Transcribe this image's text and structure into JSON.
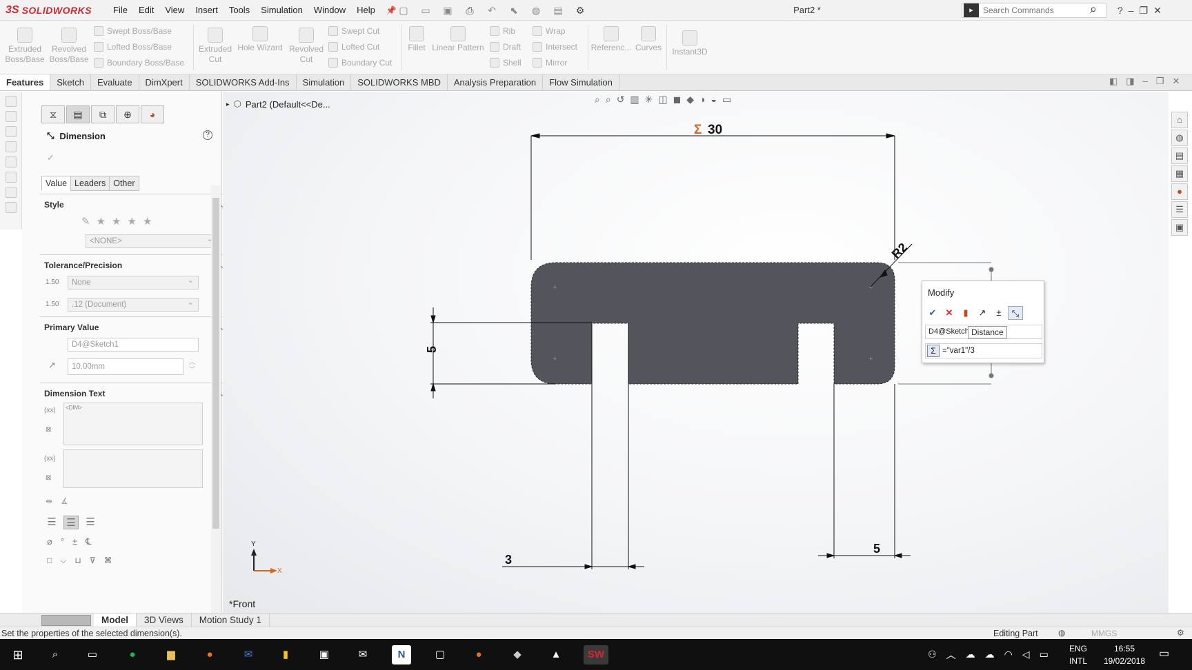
{
  "app": {
    "brand_ds": "3S",
    "brand_name": "SOLIDWORKS",
    "document_title": "Part2 *",
    "menu": [
      "File",
      "Edit",
      "View",
      "Insert",
      "Tools",
      "Simulation",
      "Window",
      "Help"
    ],
    "search_placeholder": "Search Commands",
    "help_label": "?"
  },
  "ribbon": {
    "extruded_boss": [
      "Extruded",
      "Boss/Base"
    ],
    "revolved_boss": [
      "Revolved",
      "Boss/Base"
    ],
    "swept_boss": "Swept Boss/Base",
    "lofted_boss": "Lofted Boss/Base",
    "boundary_boss": "Boundary Boss/Base",
    "extruded_cut": [
      "Extruded",
      "Cut"
    ],
    "hole_wizard": "Hole Wizard",
    "revolved_cut": [
      "Revolved",
      "Cut"
    ],
    "swept_cut": "Swept Cut",
    "lofted_cut": "Lofted Cut",
    "boundary_cut": "Boundary Cut",
    "fillet": "Fillet",
    "linear_pattern": "Linear Pattern",
    "rib": "Rib",
    "draft": "Draft",
    "shell": "Shell",
    "wrap": "Wrap",
    "intersect": "Intersect",
    "mirror": "Mirror",
    "reference": "Referenc...",
    "curves": "Curves",
    "instant3d": "Instant3D"
  },
  "command_tabs": [
    "Features",
    "Sketch",
    "Evaluate",
    "DimXpert",
    "SOLIDWORKS Add-Ins",
    "Simulation",
    "SOLIDWORKS MBD",
    "Analysis Preparation",
    "Flow Simulation"
  ],
  "property_manager": {
    "title": "Dimension",
    "help": "?",
    "subtabs": [
      "Value",
      "Leaders",
      "Other"
    ],
    "style": {
      "title": "Style",
      "favorite_value": "<NONE>"
    },
    "tolerance": {
      "title": "Tolerance/Precision",
      "tolerance_icon_text": "1.50",
      "tolerance_type": "None",
      "precision_icon_text": "1.50",
      "precision_value": ".12 (Document)"
    },
    "primary_value": {
      "title": "Primary Value",
      "name": "D4@Sketch1",
      "value": "10.00mm"
    },
    "dimension_text": {
      "title": "Dimension Text",
      "dim_token": "<DIM>",
      "paren_label": "(xx)"
    }
  },
  "graphics": {
    "tree_root": "Part2  (Default<<De...",
    "view_label": "*Front",
    "triad_y": "Y",
    "triad_x": "X",
    "dims": {
      "width_sigma": "Σ",
      "width": "30",
      "radius": "R2",
      "height": "5",
      "slot_left": "3",
      "slot_right": "5"
    }
  },
  "modify_dialog": {
    "title": "Modify",
    "name_value": "D4@Sketch",
    "tooltip": "Distance",
    "sigma": "Σ",
    "equation": "=\"var1\"/3"
  },
  "bottom_tabs": [
    "Model",
    "3D Views",
    "Motion Study 1"
  ],
  "status": {
    "message": "Set the properties of the selected dimension(s).",
    "mode": "Editing Part",
    "units": "MMGS"
  },
  "taskbar": {
    "lang_top": "ENG",
    "lang_bottom": "INTL",
    "time": "16:55",
    "date": "19/02/2018"
  },
  "colors": {
    "brand_red": "#d8262f",
    "sketch_fill": "#53545c",
    "dim_sigma": "#d2691e",
    "selection_blue": "#2f5f9e"
  }
}
